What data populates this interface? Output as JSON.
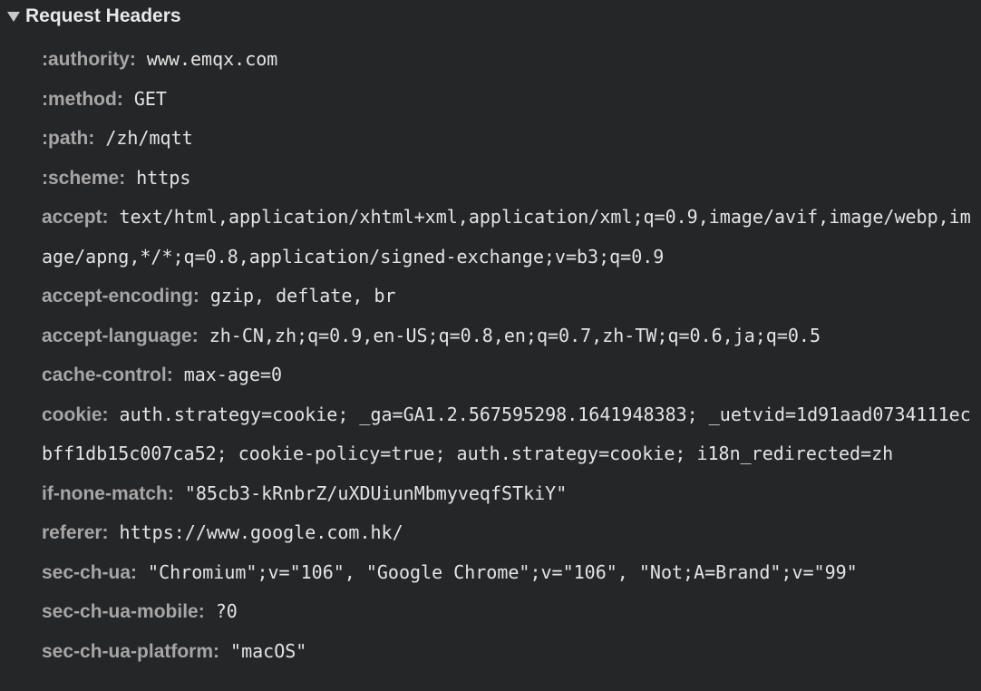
{
  "section": {
    "title": "Request Headers",
    "expanded": true,
    "toggle_icon": "triangle-down-icon"
  },
  "headers": [
    {
      "name": ":authority:",
      "value": "www.emqx.com"
    },
    {
      "name": ":method:",
      "value": "GET"
    },
    {
      "name": ":path:",
      "value": "/zh/mqtt"
    },
    {
      "name": ":scheme:",
      "value": "https"
    },
    {
      "name": "accept:",
      "value": "text/html,application/xhtml+xml,application/xml;q=0.9,image/avif,image/webp,image/apng,*/*;q=0.8,application/signed-exchange;v=b3;q=0.9"
    },
    {
      "name": "accept-encoding:",
      "value": "gzip, deflate, br"
    },
    {
      "name": "accept-language:",
      "value": "zh-CN,zh;q=0.9,en-US;q=0.8,en;q=0.7,zh-TW;q=0.6,ja;q=0.5"
    },
    {
      "name": "cache-control:",
      "value": "max-age=0"
    },
    {
      "name": "cookie:",
      "value": "auth.strategy=cookie; _ga=GA1.2.567595298.1641948383; _uetvid=1d91aad0734111ecbff1db15c007ca52; cookie-policy=true; auth.strategy=cookie; i18n_redirected=zh"
    },
    {
      "name": "if-none-match:",
      "value": "\"85cb3-kRnbrZ/uXDUiunMbmyveqfSTkiY\""
    },
    {
      "name": "referer:",
      "value": "https://www.google.com.hk/"
    },
    {
      "name": "sec-ch-ua:",
      "value": "\"Chromium\";v=\"106\", \"Google Chrome\";v=\"106\", \"Not;A=Brand\";v=\"99\""
    },
    {
      "name": "sec-ch-ua-mobile:",
      "value": "?0"
    },
    {
      "name": "sec-ch-ua-platform:",
      "value": "\"macOS\""
    }
  ]
}
